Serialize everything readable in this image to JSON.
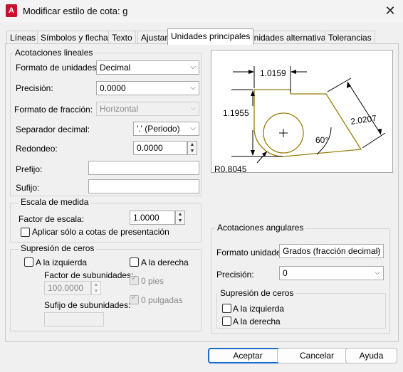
{
  "window": {
    "title": "Modificar estilo de cota: g",
    "app_icon": "A",
    "close_glyph": "✕"
  },
  "tabs": [
    {
      "label": "Líneas"
    },
    {
      "label": "Símbolos y flechas"
    },
    {
      "label": "Texto"
    },
    {
      "label": "Ajustar"
    },
    {
      "label": "Unidades principales",
      "active": true
    },
    {
      "label": "Unidades alternativas"
    },
    {
      "label": "Tolerancias"
    }
  ],
  "linear": {
    "group_label": "Acotaciones lineales",
    "unit_format_label": "Formato de unidades:",
    "unit_format_value": "Decimal",
    "precision_label": "Precisión:",
    "precision_value": "0.0000",
    "fraction_format_label": "Formato de fracción:",
    "fraction_format_value": "Horizontal",
    "decimal_sep_label": "Separador decimal:",
    "decimal_sep_value": "'.' (Periodo)",
    "round_label": "Redondeo:",
    "round_value": "0.0000",
    "prefix_label": "Prefijo:",
    "prefix_value": "",
    "suffix_label": "Sufijo:",
    "suffix_value": ""
  },
  "scale": {
    "group_label": "Escala de medida",
    "factor_label": "Factor de escala:",
    "factor_value": "1.0000",
    "layout_only_label": "Aplicar sólo a cotas de presentación"
  },
  "zero_suppression": {
    "group_label": "Supresión de ceros",
    "leading_label": "A la izquierda",
    "trailing_label": "A la derecha",
    "subunit_factor_label": "Factor de subunidades:",
    "subunit_factor_value": "100.0000",
    "subunit_suffix_label": "Sufijo de subunidades:",
    "subunit_suffix_value": "",
    "feet_label": "0 pies",
    "inches_label": "0 pulgadas"
  },
  "angular": {
    "group_label": "Acotaciones angulares",
    "units_format_label": "Formato unidades:",
    "units_format_value": "Grados (fracción decimal)",
    "precision_label": "Precisión:",
    "precision_value": "0",
    "zero_group_label": "Supresión de ceros",
    "leading_label": "A la izquierda",
    "trailing_label": "A la derecha"
  },
  "preview": {
    "dim_top": "1.0159",
    "dim_left": "1.1955",
    "dim_right": "2.0207",
    "dim_angle": "60°",
    "dim_radius": "R0.8045",
    "shape_color": "#9a7d0a"
  },
  "buttons": {
    "ok": "Aceptar",
    "cancel": "Cancelar",
    "help": "Ayuda"
  },
  "icons": {
    "spin_up": "▲",
    "spin_down": "▼",
    "dropdown": "⌵"
  }
}
